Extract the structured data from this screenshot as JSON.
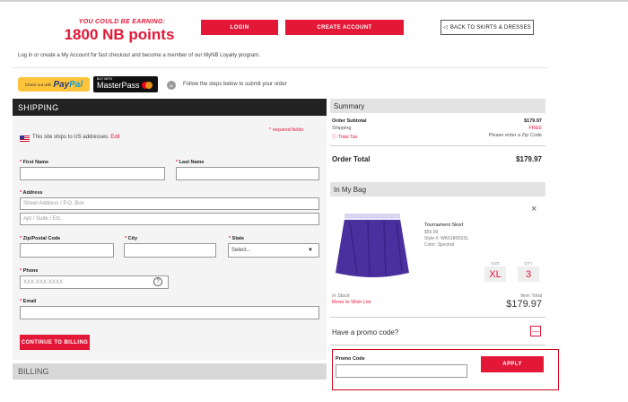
{
  "header": {
    "earn_small": "YOU COULD BE EARNING:",
    "earn_big": "1800 NB points",
    "login": "LOGIN",
    "create_account": "CREATE ACCOUNT",
    "back": "BACK TO SKIRTS & DRESSES"
  },
  "intro": "Log in or create a My Account for fast checkout and become a member of our MyNB Loyalty program.",
  "express": {
    "paypal_prefix": "Check out with",
    "paypal_brand_a": "Pay",
    "paypal_brand_b": "Pal",
    "masterpass_small": "BUY WITH",
    "masterpass_brand": "MasterPass",
    "or": "or",
    "follow": "Follow the steps below to submit your order"
  },
  "shipping": {
    "title": "SHIPPING",
    "required": "required fields",
    "ships_to": "This site ships to US addresses.",
    "edit": "Edit",
    "first_name": "First Name",
    "last_name": "Last Name",
    "address": "Address",
    "address1_placeholder": "Street Address / P.O. Box",
    "address2_placeholder": "Apt / Suite / Etc.",
    "zip": "Zip/Postal Code",
    "city": "City",
    "state": "State",
    "state_select": "Select...",
    "phone": "Phone",
    "phone_placeholder": "XXX-XXX-XXXX",
    "help": "?",
    "email": "Email",
    "continue": "CONTINUE TO BILLING"
  },
  "billing": {
    "title": "BILLING"
  },
  "summary": {
    "title": "Summary",
    "subtotal_label": "Order Subtotal",
    "subtotal_value": "$179.97",
    "shipping_label": "Shipping",
    "shipping_value": "FREE",
    "tax_label": "Total Tax",
    "tax_value": "Please enter a Zip Code",
    "total_label": "Order Total",
    "total_value": "$179.97"
  },
  "bag": {
    "title": "In My Bag",
    "close": "×",
    "product_name": "Tournament Skort",
    "price": "$59.99",
    "style": "Style #: WK61806SSL",
    "color": "Color: Spectral",
    "size_label": "SIZE",
    "size_value": "XL",
    "qty_label": "QTY",
    "qty_value": "3",
    "stock": "In Stock",
    "wishlist": "Move to Wish List",
    "item_total_label": "Item Total",
    "item_total_value": "$179.97"
  },
  "promo": {
    "question": "Have a promo code?",
    "toggle": "—",
    "label": "Promo Code",
    "apply": "APPLY"
  },
  "colors": {
    "accent": "#e31837",
    "dark": "#222222",
    "panel": "#f4f4f4"
  }
}
